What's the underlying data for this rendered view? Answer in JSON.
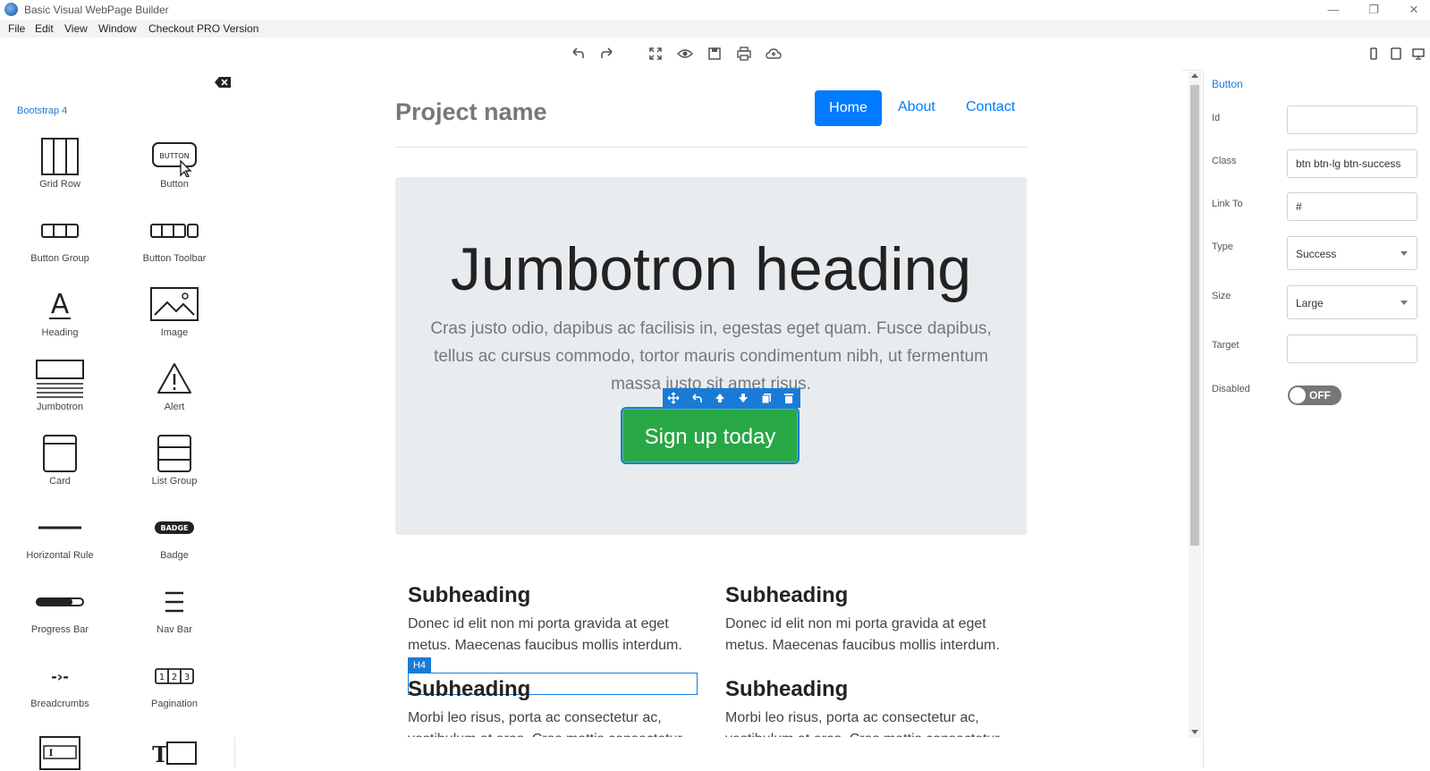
{
  "window": {
    "title": "Basic Visual WebPage Builder",
    "minimize": "—",
    "maximize": "❐",
    "close": "✕"
  },
  "menu": {
    "file": "File",
    "edit": "Edit",
    "view": "View",
    "window": "Window",
    "pro": "Checkout PRO Version"
  },
  "toolbar": [
    "undo-icon",
    "redo-icon",
    "fullscreen-icon",
    "preview-icon",
    "save-icon",
    "print-icon",
    "cloud-upload-icon"
  ],
  "device_buttons": [
    "phone-icon",
    "tablet-icon",
    "desktop-icon"
  ],
  "left_panel": {
    "framework": "Bootstrap 4",
    "components": [
      {
        "label": "Grid Row"
      },
      {
        "label": "Button"
      },
      {
        "label": "Button Group"
      },
      {
        "label": "Button Toolbar"
      },
      {
        "label": "Heading"
      },
      {
        "label": "Image"
      },
      {
        "label": "Jumbotron"
      },
      {
        "label": "Alert"
      },
      {
        "label": "Card"
      },
      {
        "label": "List Group"
      },
      {
        "label": "Horizontal Rule"
      },
      {
        "label": "Badge"
      },
      {
        "label": "Progress Bar"
      },
      {
        "label": "Nav Bar"
      },
      {
        "label": "Breadcrumbs"
      },
      {
        "label": "Pagination"
      }
    ],
    "icon_texts": {
      "button": "BUTTON",
      "heading_glyph": "A",
      "badge": "BADGE",
      "pagination": [
        "1",
        "2",
        "3"
      ],
      "breadcrumb": "-›-",
      "input_glyph": "I",
      "textfield_glyph": "T"
    }
  },
  "canvas": {
    "project_name": "Project name",
    "nav": {
      "home": "Home",
      "about": "About",
      "contact": "Contact"
    },
    "jumbotron": {
      "heading": "Jumbotron heading",
      "text": "Cras justo odio, dapibus ac facilisis in, egestas eget quam. Fusce dapibus, tellus ac cursus commodo, tortor mauris condimentum nibh, ut fermentum massa justo sit amet risus.",
      "button": "Sign up today"
    },
    "selection_tools": [
      "move-icon",
      "select-parent-icon",
      "move-up-icon",
      "move-down-icon",
      "clone-icon",
      "delete-icon"
    ],
    "h4_badge": "H4",
    "sections": [
      {
        "heading": "Subheading",
        "text": "Donec id elit non mi porta gravida at eget metus. Maecenas faucibus mollis interdum."
      },
      {
        "heading": "Subheading",
        "text": "Donec id elit non mi porta gravida at eget metus. Maecenas faucibus mollis interdum."
      },
      {
        "heading": "Subheading",
        "text": "Morbi leo risus, porta ac consectetur ac, vestibulum at eros. Cras mattis consectetur"
      },
      {
        "heading": "Subheading",
        "text": "Morbi leo risus, porta ac consectetur ac, vestibulum at eros. Cras mattis consectetur"
      }
    ]
  },
  "properties": {
    "title": "Button",
    "id_label": "Id",
    "id_value": "",
    "class_label": "Class",
    "class_value": "btn btn-lg btn-success",
    "link_label": "Link To",
    "link_value": "#",
    "type_label": "Type",
    "type_value": "Success",
    "size_label": "Size",
    "size_value": "Large",
    "target_label": "Target",
    "target_value": "",
    "disabled_label": "Disabled",
    "disabled_state": "OFF"
  },
  "colors": {
    "accent": "#1a7bd6",
    "primary": "#007bff",
    "success": "#28a745",
    "jumbotron_bg": "#e9ecef"
  }
}
